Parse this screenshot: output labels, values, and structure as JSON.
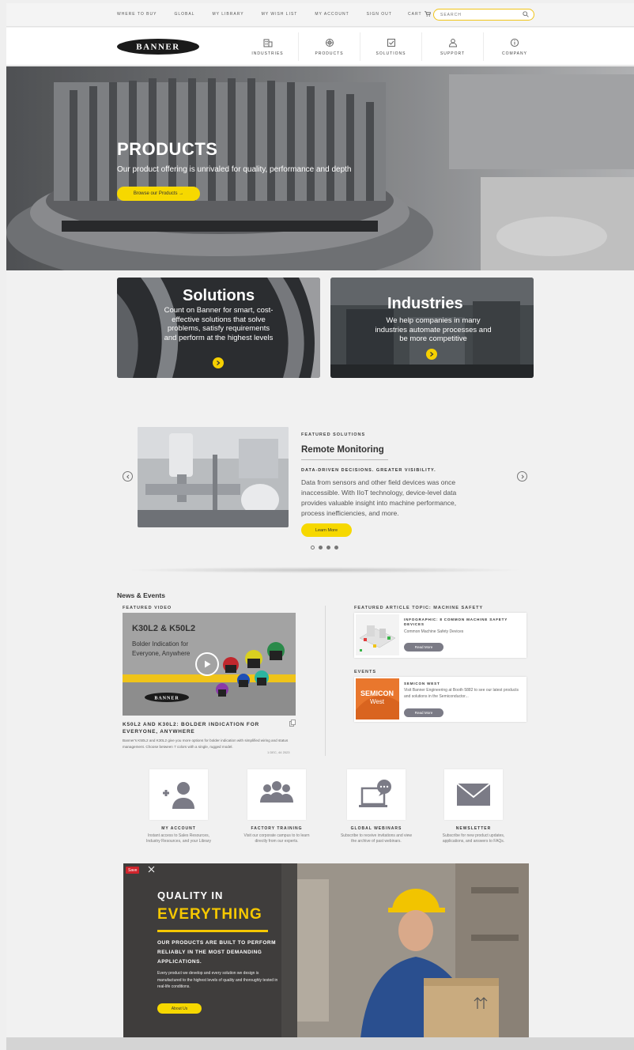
{
  "utility": {
    "links": [
      "WHERE TO BUY",
      "GLOBAL",
      "MY LIBRARY",
      "MY WISH LIST",
      "MY ACCOUNT",
      "SIGN OUT"
    ],
    "cart": "CART",
    "search_placeholder": "SEARCH"
  },
  "nav": {
    "logo": "BANNER",
    "items": [
      "INDUSTRIES",
      "PRODUCTS",
      "SOLUTIONS",
      "SUPPORT",
      "COMPANY"
    ]
  },
  "hero": {
    "title": "PRODUCTS",
    "subtitle": "Our product offering is unrivaled for quality, performance and depth",
    "button": "Browse our Products →"
  },
  "tiles": [
    {
      "title": "Solutions",
      "text": "Count on Banner for smart, cost-effective solutions that solve problems, satisfy requirements and perform at the highest levels"
    },
    {
      "title": "Industries",
      "text": "We help companies in many industries automate processes and be more competitive"
    }
  ],
  "featured": {
    "kicker": "FEATURED SOLUTIONS",
    "title": "Remote Monitoring",
    "tagline": "DATA-DRIVEN DECISIONS. GREATER VISIBILITY.",
    "body": "Data from sensors and other field devices was once inaccessible. With IIoT technology, device-level data provides valuable insight into machine performance, process inefficiencies, and more.",
    "button": "Learn More",
    "active_slide": 1,
    "slide_count": 4
  },
  "news": {
    "heading": "News & Events",
    "featured_video_label": "FEATURED VIDEO",
    "video": {
      "title": "K30L2 & K50L2",
      "description": "Bolder Indication for Everyone, Anywhere",
      "brand": "BANNER",
      "caption": "K50L2 AND K30L2: BOLDER INDICATION FOR EVERYONE, ANYWHERE",
      "text": "Banner's K50L2 and K30L2 give you more options for bolder indication with simplified wiring and status management. Choose between 7 colors with a single, rugged model.",
      "date": "1 DEC, 44 2023"
    },
    "article_label": "FEATURED ARTICLE TOPIC: MACHINE SAFETY",
    "article": {
      "title": "INFOGRAPHIC: 8 COMMON MACHINE SAFETY DEVICES",
      "text": "Common Machine Safety Devices",
      "button": "Read More"
    },
    "events_label": "EVENTS",
    "event": {
      "thumb_line1": "SEMICON",
      "thumb_line2": "West",
      "title": "SEMICON WEST",
      "text": "Visit Banner Engineering at Booth 5882 to see our latest products and solutions in the Semiconductor...",
      "button": "Read More"
    }
  },
  "features": [
    {
      "icon": "add-user-icon",
      "title": "MY ACCOUNT",
      "text": "Instant access to Sales Resources, Industry Resources, and your Library"
    },
    {
      "icon": "group-icon",
      "title": "FACTORY TRAINING",
      "text": "Visit our corporate campus to to learn directly from our experts."
    },
    {
      "icon": "webinar-icon",
      "title": "GLOBAL WEBINARS",
      "text": "Subscribe to receive invitations and view the archive of past webinars."
    },
    {
      "icon": "envelope-icon",
      "title": "NEWSLETTER",
      "text": "Subscribe for new product updates, applications, and answers to FAQs."
    }
  ],
  "quality": {
    "save": "Save",
    "line1": "QUALITY IN",
    "line2": "EVERYTHING",
    "subhead": "OUR PRODUCTS ARE BUILT TO PERFORM RELIABLY IN THE MOST DEMANDING APPLICATIONS.",
    "body": "Every product we develop and every solution we design is manufactured to the highest levels of quality and thoroughly tested in real-life conditions.",
    "button": "About Us"
  },
  "colors": {
    "accent": "#f6d800",
    "button_gray": "#7b7b86"
  }
}
